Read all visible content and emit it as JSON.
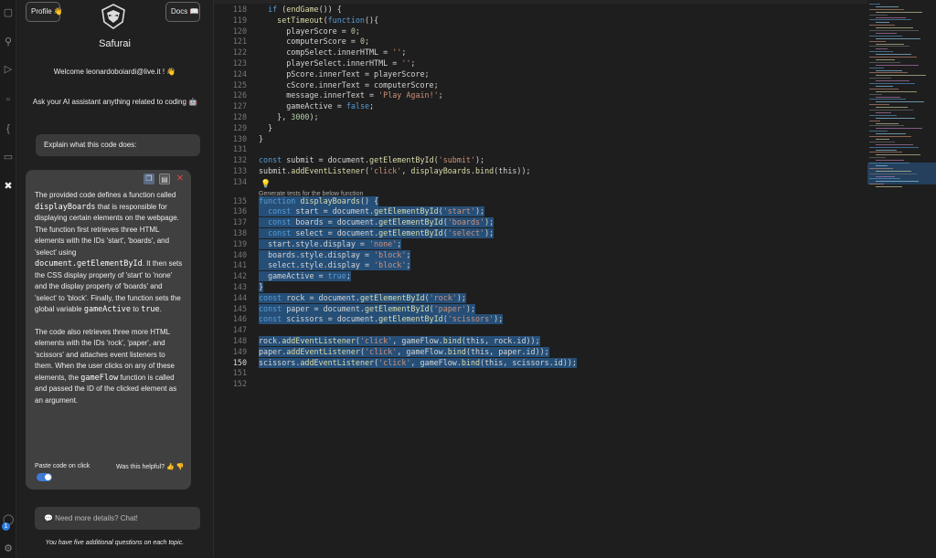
{
  "colors": {
    "accent": "#3e7ad6",
    "selection": "#264f78",
    "close": "#e04848"
  },
  "sidebar": {
    "profile_label": "Profile 👋",
    "docs_label": "Docs 📖",
    "brand": "Safurai",
    "welcome": "Welcome leonardoboiardi@live.it ! 👋",
    "ask": "Ask your AI assistant anything related to coding 🤖",
    "question": "Explain what this code does:",
    "answer": {
      "p1_a": "The provided code defines a function called",
      "p1_code1": "displayBoards",
      "p1_b": "that is responsible for displaying certain elements on the webpage. The function first retrieves three HTML elements with the IDs 'start', 'boards', and 'select' using",
      "p1_code2": "document.getElementById",
      "p1_c": ". It then sets the CSS display property of 'start' to 'none' and the display property of 'boards' and 'select' to 'block'. Finally, the function sets the global variable",
      "p1_code3": "gameActive",
      "p1_d": "to",
      "p1_code4": "true",
      "p1_e": ".",
      "p2_a": "The code also retrieves three more HTML elements with the IDs 'rock', 'paper', and 'scissors' and attaches event listeners to them. When the user clicks on any of these elements, the",
      "p2_code": "gameFlow",
      "p2_b": "function is called and passed the ID of the clicked element as an argument."
    },
    "paste_label": "Paste code on click",
    "helpful_label": "Was this helpful? 👍 👎",
    "chat_placeholder": "💬  Need more details? Chat!",
    "footer": "You have five additional questions on each topic."
  },
  "editor": {
    "code_lens": "Generate tests for the below function",
    "lines": [
      {
        "n": "118",
        "code": "  if (endGame()) {"
      },
      {
        "n": "119",
        "code": "    setTimeout(function(){"
      },
      {
        "n": "120",
        "code": "      playerScore = 0;"
      },
      {
        "n": "121",
        "code": "      computerScore = 0;"
      },
      {
        "n": "122",
        "code": "      compSelect.innerHTML = '';"
      },
      {
        "n": "123",
        "code": "      playerSelect.innerHTML = '';"
      },
      {
        "n": "124",
        "code": "      pScore.innerText = playerScore;"
      },
      {
        "n": "125",
        "code": "      cScore.innerText = computerScore;"
      },
      {
        "n": "126",
        "code": "      message.innerText = 'Play Again!';"
      },
      {
        "n": "127",
        "code": "      gameActive = false;"
      },
      {
        "n": "128",
        "code": "    }, 3000);"
      },
      {
        "n": "129",
        "code": "  }"
      },
      {
        "n": "130",
        "code": "}"
      },
      {
        "n": "131",
        "code": ""
      },
      {
        "n": "132",
        "code": "const submit = document.getElementById('submit');"
      },
      {
        "n": "133",
        "code": "submit.addEventListener('click', displayBoards.bind(this));"
      },
      {
        "n": "134",
        "code": ""
      },
      {
        "n": "135",
        "code": "function displayBoards() {"
      },
      {
        "n": "136",
        "code": "  const start = document.getElementById('start');"
      },
      {
        "n": "137",
        "code": "  const boards = document.getElementById('boards');"
      },
      {
        "n": "138",
        "code": "  const select = document.getElementById('select');"
      },
      {
        "n": "139",
        "code": "  start.style.display = 'none';"
      },
      {
        "n": "140",
        "code": "  boards.style.display = 'block';"
      },
      {
        "n": "141",
        "code": "  select.style.display = 'block';"
      },
      {
        "n": "142",
        "code": "  gameActive = true;"
      },
      {
        "n": "143",
        "code": "}"
      },
      {
        "n": "144",
        "code": "const rock = document.getElementById('rock');"
      },
      {
        "n": "145",
        "code": "const paper = document.getElementById('paper');"
      },
      {
        "n": "146",
        "code": "const scissors = document.getElementById('scissors');"
      },
      {
        "n": "147",
        "code": ""
      },
      {
        "n": "148",
        "code": "rock.addEventListener('click', gameFlow.bind(this, rock.id));"
      },
      {
        "n": "149",
        "code": "paper.addEventListener('click', gameFlow.bind(this, paper.id));"
      },
      {
        "n": "150",
        "code": "scissors.addEventListener('click', gameFlow.bind(this, scissors.id));"
      },
      {
        "n": "151",
        "code": ""
      },
      {
        "n": "152",
        "code": ""
      }
    ],
    "selected_lines": [
      "135",
      "136",
      "137",
      "138",
      "139",
      "140",
      "141",
      "142",
      "143",
      "144",
      "145",
      "146",
      "147",
      "148",
      "149",
      "150"
    ],
    "current_line": "150"
  },
  "icons": {
    "activity": [
      "explorer-icon",
      "search-icon",
      "source-control-icon",
      "run-debug-icon",
      "extensions-icon",
      "remote-icon",
      "safurai-icon",
      "account-icon",
      "settings-icon"
    ]
  }
}
